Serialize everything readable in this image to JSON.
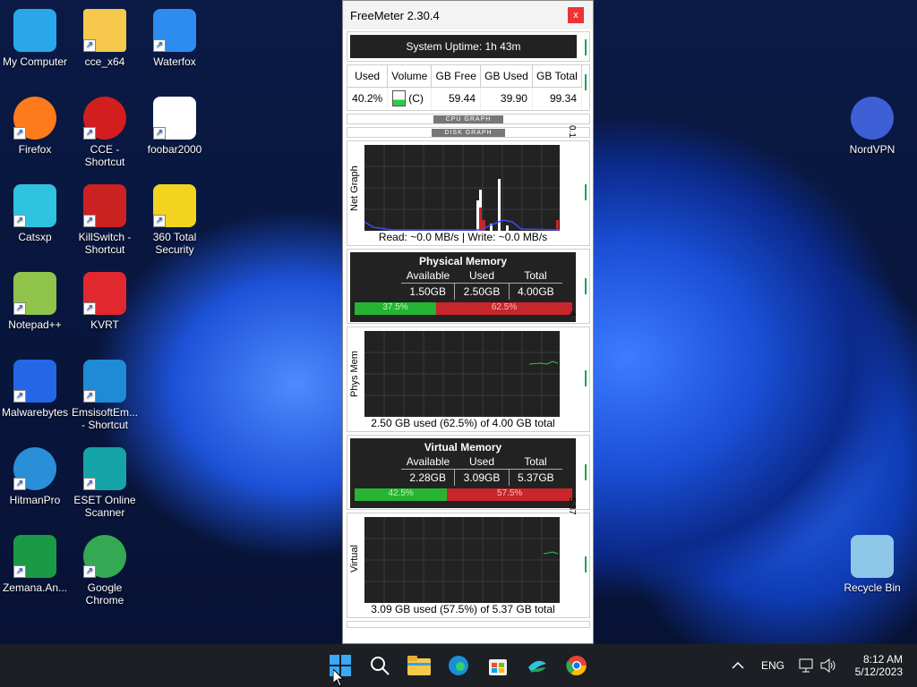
{
  "desktop_icons": [
    {
      "label": "My Computer",
      "icon": "monitor-icon",
      "color": "#2aa7e8"
    },
    {
      "label": "cce_x64",
      "icon": "folder-icon",
      "color": "#f6c94c"
    },
    {
      "label": "Waterfox",
      "icon": "waterfox-icon",
      "color": "#2d8cf0"
    },
    {
      "label": "Firefox",
      "icon": "firefox-icon",
      "color": "#ff7a1a"
    },
    {
      "label": "CCE - Shortcut",
      "icon": "cce-icon",
      "color": "#d21e1e"
    },
    {
      "label": "foobar2000",
      "icon": "foobar-icon",
      "color": "#ffffff"
    },
    {
      "label": "Catsxp",
      "icon": "catsxp-icon",
      "color": "#2fc3e0"
    },
    {
      "label": "KillSwitch - Shortcut",
      "icon": "killswitch-icon",
      "color": "#cc2222"
    },
    {
      "label": "360 Total Security",
      "icon": "360-icon",
      "color": "#f2d41e"
    },
    {
      "label": "Notepad++",
      "icon": "notepad-icon",
      "color": "#8fc34a"
    },
    {
      "label": "KVRT",
      "icon": "kvrt-icon",
      "color": "#e0282e"
    },
    {
      "label": "Malwarebytes",
      "icon": "malwarebytes-icon",
      "color": "#2367e6"
    },
    {
      "label": "EmsisoftEm... - Shortcut",
      "icon": "emsisoft-icon",
      "color": "#1f8ad6"
    },
    {
      "label": "HitmanPro",
      "icon": "hitmanpro-icon",
      "color": "#2a8ed8"
    },
    {
      "label": "ESET Online Scanner",
      "icon": "eset-icon",
      "color": "#16a3a8"
    },
    {
      "label": "Zemana.An...",
      "icon": "zemana-icon",
      "color": "#1b9a46"
    },
    {
      "label": "Google Chrome",
      "icon": "chrome-icon",
      "color": "#34a853"
    },
    {
      "label": "NordVPN",
      "icon": "nordvpn-icon",
      "color": "#3e5fd6"
    },
    {
      "label": "Recycle Bin",
      "icon": "recycle-bin-icon",
      "color": "#8fc7e8"
    }
  ],
  "freemeter": {
    "title": "FreeMeter 2.30.4",
    "close": "x",
    "uptime": "System Uptime:  1h  43m",
    "disk_headers": [
      "Used",
      "Volume",
      "GB Free",
      "GB Used",
      "GB Total"
    ],
    "disk_row": {
      "used": "40.2%",
      "volume": "(C)",
      "free": "59.44",
      "gbused": "39.90",
      "total": "99.34",
      "fill_fraction": 0.402
    },
    "cpu_graph_label": "CPU GRAPH",
    "disk_graph_label": "DISK GRAPH",
    "net_graph": {
      "label": "Net Graph",
      "scale": "0.1",
      "caption": "Read: ~0.0 MB/s  |  Write: ~0.0 MB/s"
    },
    "physical_memory": {
      "title": "Physical Memory",
      "headers": [
        "Available",
        "Used",
        "Total"
      ],
      "values": [
        "1.50GB",
        "2.50GB",
        "4.00GB"
      ],
      "available_pct": "37.5%",
      "used_pct": "62.5%",
      "available_fraction": 0.375
    },
    "phys_graph": {
      "label": "Phys Mem",
      "scale": "4",
      "caption": "2.50 GB used (62.5%) of 4.00 GB total"
    },
    "virtual_memory": {
      "title": "Virtual Memory",
      "headers": [
        "Available",
        "Used",
        "Total"
      ],
      "values": [
        "2.28GB",
        "3.09GB",
        "5.37GB"
      ],
      "available_pct": "42.5%",
      "used_pct": "57.5%",
      "available_fraction": 0.425
    },
    "virtual_graph": {
      "label": "Virtual",
      "scale": "5.37",
      "caption": "3.09 GB used (57.5%) of 5.37 GB total"
    }
  },
  "taskbar": {
    "items": [
      "start-icon",
      "search-icon",
      "file-explorer-icon",
      "edge-icon",
      "store-icon",
      "catsxp-icon",
      "chrome-icon"
    ],
    "lang": "ENG",
    "time": "8:12 AM",
    "date": "5/12/2023"
  },
  "colors": {
    "accent_green": "#27b334",
    "accent_red": "#c7262a",
    "panel_dark": "#222222"
  }
}
